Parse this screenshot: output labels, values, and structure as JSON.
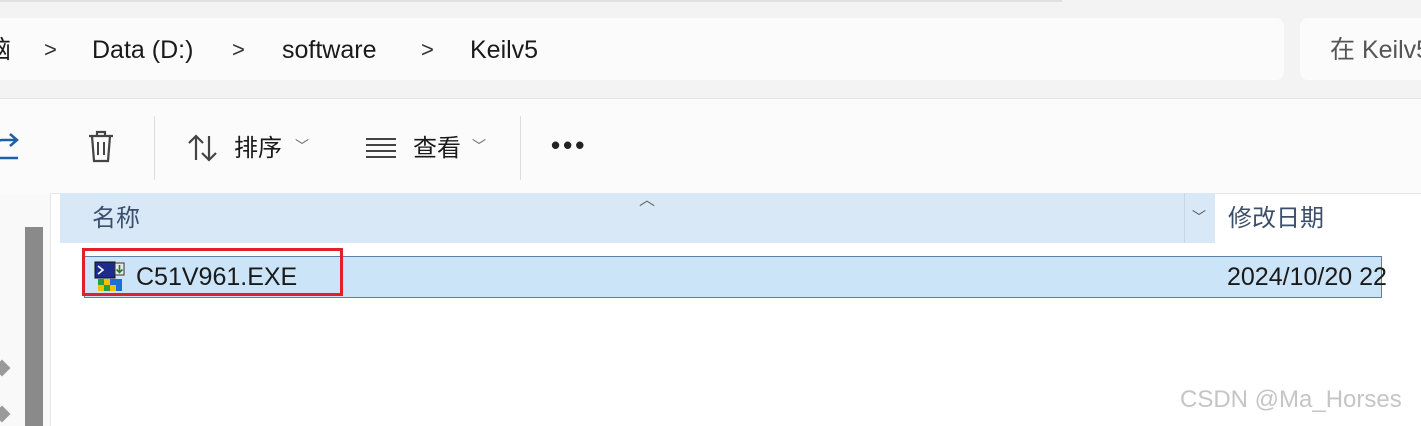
{
  "breadcrumb": {
    "items": [
      "脑",
      "Data (D:)",
      "software",
      "Keilv5"
    ],
    "separator": ">"
  },
  "search": {
    "placeholder": "在 Keilv5"
  },
  "toolbar": {
    "sort_label": "排序",
    "view_label": "查看",
    "more_label": "•••"
  },
  "columns": {
    "name": "名称",
    "date": "修改日期"
  },
  "files": [
    {
      "name": "C51V961.EXE",
      "date": "2024/10/20 22",
      "selected": true
    }
  ],
  "watermark": "CSDN @Ma_Horses",
  "colors": {
    "selection": "#cce4f7",
    "header": "#d8e8f6",
    "highlight_border": "#e0202a"
  }
}
